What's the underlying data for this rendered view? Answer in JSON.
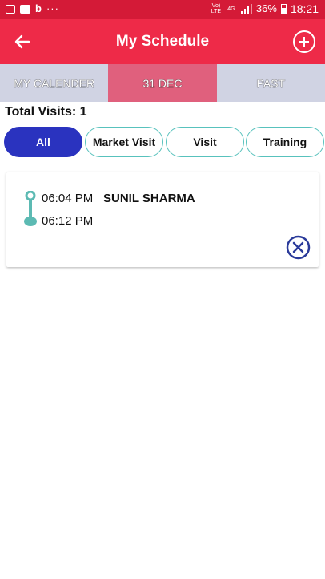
{
  "status_bar": {
    "left_icons": [
      "gallery-icon",
      "outlook-icon",
      "b-icon",
      "more-dots-icon"
    ],
    "b_label": "b",
    "dots": "···",
    "volte": "Vo) LTE",
    "network": "4G",
    "battery_percent": "36%",
    "time": "18:21"
  },
  "app_bar": {
    "title": "My Schedule",
    "back_icon": "back-arrow-icon",
    "add_icon": "add-circle-icon"
  },
  "tabs": [
    {
      "label": "MY CALENDER",
      "active": false
    },
    {
      "label": "31 DEC",
      "active": true
    },
    {
      "label": "PAST",
      "active": false
    }
  ],
  "total_visits": "Total Visits: 1",
  "filters": [
    {
      "label": "All",
      "active": true
    },
    {
      "label": "Market Visit",
      "active": false
    },
    {
      "label": "Visit",
      "active": false
    },
    {
      "label": "Training",
      "active": false
    }
  ],
  "visits": [
    {
      "start_time": "06:04 PM",
      "end_time": "06:12 PM",
      "name": "SUNIL SHARMA",
      "cancel_icon": "cancel-circle-icon"
    }
  ],
  "colors": {
    "status_bar": "#d41a37",
    "app_bar": "#ee2a48",
    "tab_inactive": "#d0d3e3",
    "tab_active": "#e0607d",
    "chip_active": "#2a33bf",
    "chip_border": "#58c2bd",
    "timeline": "#5cbab3",
    "cancel": "#2a3a9a"
  }
}
